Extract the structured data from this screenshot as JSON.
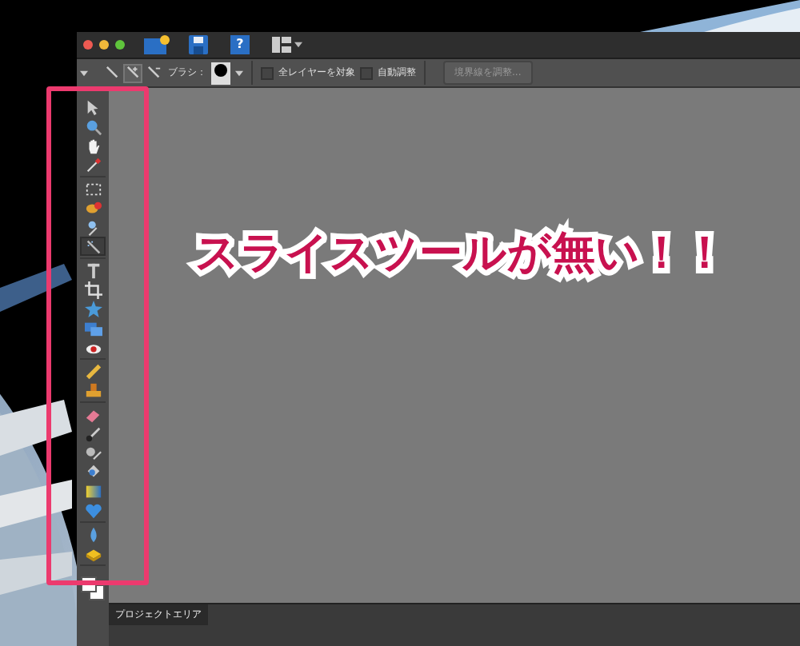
{
  "window": {
    "title_bar": {
      "traffic_lights": [
        {
          "color": "#ee5a52"
        },
        {
          "color": "#f2b93a"
        },
        {
          "color": "#5fc43c"
        }
      ],
      "help_label": "?"
    },
    "options_bar": {
      "modes": [
        {
          "selected": false
        },
        {
          "selected": true
        },
        {
          "selected": false
        }
      ],
      "brush_label": "ブラシ：",
      "checkboxes": [
        {
          "label": "全レイヤーを対象",
          "checked": false
        },
        {
          "label": "自動調整",
          "checked": false
        }
      ],
      "refine_button": {
        "label": "境界線を調整...",
        "disabled": true
      }
    },
    "tool_groups": [
      {
        "tools": [
          {
            "kind": "move",
            "selected": false
          },
          {
            "kind": "zoom",
            "selected": false
          },
          {
            "kind": "hand",
            "selected": false
          },
          {
            "kind": "eyedropper",
            "selected": false
          }
        ]
      },
      {
        "tools": [
          {
            "kind": "marquee",
            "selected": false
          },
          {
            "kind": "lasso",
            "selected": false
          },
          {
            "kind": "magic-wand",
            "selected": false
          },
          {
            "kind": "selection-brush",
            "selected": true
          }
        ]
      },
      {
        "tools": [
          {
            "kind": "text",
            "selected": false
          },
          {
            "kind": "crop",
            "selected": false
          },
          {
            "kind": "cookie-cutter",
            "selected": false
          },
          {
            "kind": "straighten",
            "selected": false
          },
          {
            "kind": "red-eye",
            "selected": false
          }
        ]
      },
      {
        "tools": [
          {
            "kind": "healing",
            "selected": false
          },
          {
            "kind": "stamp",
            "selected": false
          }
        ]
      },
      {
        "tools": [
          {
            "kind": "eraser",
            "selected": false
          },
          {
            "kind": "brush",
            "selected": false
          },
          {
            "kind": "smart-brush",
            "selected": false
          },
          {
            "kind": "paint-bucket",
            "selected": false
          },
          {
            "kind": "gradient",
            "selected": false
          },
          {
            "kind": "shape",
            "selected": false
          }
        ]
      },
      {
        "tools": [
          {
            "kind": "blur",
            "selected": false
          },
          {
            "kind": "sponge",
            "selected": false
          }
        ]
      }
    ],
    "project_area": {
      "tab": "プロジェクトエリア"
    }
  },
  "annotation": {
    "text": "スライスツールが無い！！"
  }
}
